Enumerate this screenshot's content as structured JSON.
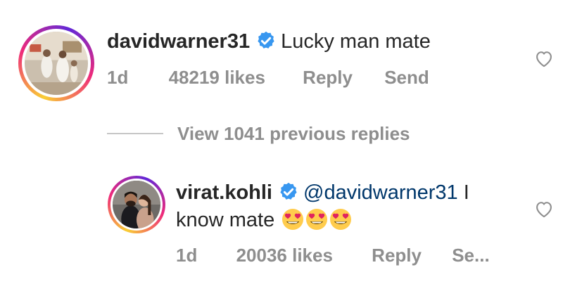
{
  "comment1": {
    "username": "davidwarner31",
    "text": "Lucky man mate",
    "time": "1d",
    "likes": "48219 likes",
    "reply_label": "Reply",
    "send_label": "Send"
  },
  "view_replies": {
    "label": "View 1041 previous replies"
  },
  "comment2": {
    "username": "virat.kohli",
    "mention": "@davidwarner31",
    "text_line1_tail": " I",
    "text_line2": "know mate",
    "emoji_name": "heart-eyes-emoji",
    "emoji_count": 3,
    "time": "1d",
    "likes": "20036 likes",
    "reply_label": "Reply",
    "send_label": "Se..."
  },
  "colors": {
    "verified_badge": "#3897f0",
    "meta_text": "#8e8e8e",
    "mention": "#00376b",
    "heart_outline": "#8e8e8e"
  },
  "icons": [
    "verified-badge-icon",
    "heart-outline-icon",
    "heart-eyes-emoji"
  ]
}
